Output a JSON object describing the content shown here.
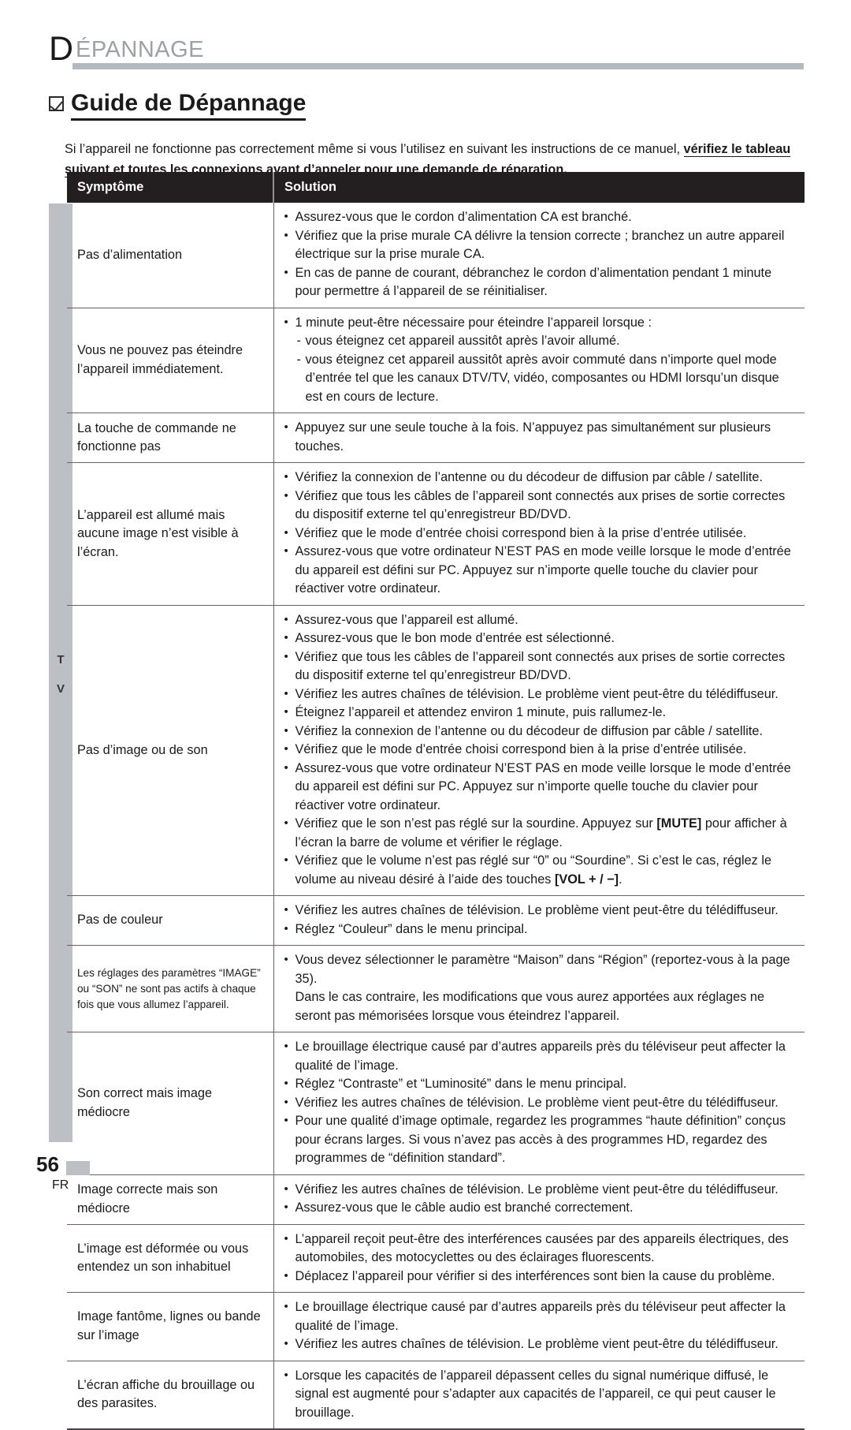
{
  "header": {
    "dropcap": "D",
    "rest": "ÉPANNAGE"
  },
  "section": {
    "title": "Guide de Dépannage",
    "icon": "checkbox-checked-icon"
  },
  "intro": {
    "normal": "Si l’appareil ne fonctionne pas correctement même si vous l’utilisez en suivant les instructions de ce manuel, ",
    "bold": "vérifiez le tableau suivant et toutes les connexions avant d’appeler pour une demande de réparation."
  },
  "side_tab": {
    "letters": [
      "T",
      "V"
    ]
  },
  "table": {
    "headers": {
      "symptom": "Symptôme",
      "solution": "Solution"
    },
    "rows": [
      {
        "symptom": "Pas d’alimentation",
        "solutions": [
          "Assurez-vous que le cordon d’alimentation CA est branché.",
          "Vérifiez que la prise murale CA délivre la tension correcte ; branchez un autre appareil électrique sur la prise murale CA.",
          "En cas de panne de courant, débranchez le cordon d’alimentation pendant 1 minute pour permettre á l’appareil de se réinitialiser."
        ]
      },
      {
        "symptom": "Vous ne pouvez pas éteindre l’appareil immédiatement.",
        "solutions": [
          "1 minute peut-être nécessaire pour éteindre l’appareil lorsque :"
        ],
        "sub_solutions": [
          "vous éteignez cet appareil aussitôt après l’avoir allumé.",
          "vous éteignez cet appareil aussitôt après avoir commuté dans n’importe quel mode d’entrée tel que les canaux DTV/TV, vidéo, composantes ou HDMI lorsqu’un disque est en cours de lecture."
        ]
      },
      {
        "symptom": "La touche de commande ne fonctionne pas",
        "solutions": [
          "Appuyez sur une seule touche à la fois. N’appuyez pas simultanément sur plusieurs touches."
        ]
      },
      {
        "symptom": "L’appareil est allumé mais aucune image n’est visible à l’écran.",
        "solutions": [
          "Vérifiez la connexion de l’antenne ou du décodeur de diffusion par câble / satellite.",
          "Vérifiez que tous les câbles de l’appareil sont connectés aux prises de sortie correctes du dispositif externe tel qu’enregistreur BD/DVD.",
          "Vérifiez que le mode d’entrée choisi correspond bien à la prise d’entrée utilisée.",
          "Assurez-vous que votre ordinateur N’EST PAS en mode veille lorsque le mode d’entrée du appareil est défini sur PC. Appuyez sur n’importe quelle touche du clavier pour réactiver votre ordinateur."
        ]
      },
      {
        "symptom": "Pas d’image ou de son",
        "solutions": [
          "Assurez-vous que l’appareil est allumé.",
          "Assurez-vous que le bon mode d’entrée est sélectionné.",
          "Vérifiez que tous les câbles de l’appareil sont connectés aux prises de sortie correctes du dispositif externe tel qu’enregistreur BD/DVD.",
          "Vérifiez les autres chaînes de télévision. Le problème vient peut-être du télédiffuseur.",
          "Éteignez l’appareil et attendez environ 1 minute, puis rallumez-le.",
          "Vérifiez la connexion de l’antenne ou du décodeur de diffusion par câble / satellite.",
          "Vérifiez que le mode d’entrée choisi correspond bien à la prise d’entrée utilisée.",
          "Assurez-vous que votre ordinateur N’EST PAS en mode veille lorsque le mode d’entrée du appareil est défini sur PC. Appuyez sur n’importe quelle touche du clavier pour réactiver votre ordinateur."
        ],
        "solutions_rich": [
          {
            "pre": "Vérifiez que le son n’est pas réglé sur la sourdine. Appuyez sur ",
            "kbd": "[MUTE]",
            "post": " pour afficher à l’écran la barre de volume et vérifier le réglage."
          },
          {
            "pre": "Vérifiez que le volume n’est pas réglé sur “0” ou “Sourdine”. Si c’est le cas, réglez le volume au niveau désiré à l’aide des touches ",
            "kbd": "[VOL + / −]",
            "post": "."
          }
        ]
      },
      {
        "symptom": "Pas de couleur",
        "solutions": [
          "Vérifiez les autres chaînes de télévision. Le problème vient peut-être du télédiffuseur.",
          "Réglez “Couleur” dans le menu principal."
        ]
      },
      {
        "symptom": "Les réglages des paramètres “IMAGE” ou “SON” ne sont pas actifs à chaque fois que vous allumez l’appareil.",
        "symptom_small": true,
        "solutions": [
          "Vous devez sélectionner le paramètre “Maison” dans “Région” (reportez-vous à la page 35)."
        ],
        "continuation": "Dans le cas contraire, les modifications que vous aurez apportées aux réglages ne seront pas mémorisées lorsque vous éteindrez l’appareil."
      },
      {
        "symptom": "Son correct mais image médiocre",
        "solutions": [
          "Le brouillage électrique causé par d’autres appareils près du téléviseur peut affecter la qualité de l’image.",
          "Réglez “Contraste” et “Luminosité” dans le menu principal.",
          "Vérifiez les autres chaînes de télévision. Le problème vient peut-être du télédiffuseur.",
          "Pour une qualité d’image optimale, regardez les programmes “haute définition” conçus pour écrans larges. Si vous n’avez pas accès à des programmes HD, regardez des programmes de “définition standard”."
        ]
      },
      {
        "symptom": "Image correcte mais son médiocre",
        "solutions": [
          "Vérifiez les autres chaînes de télévision. Le problème vient peut-être du télédiffuseur.",
          "Assurez-vous que le câble audio est branché correctement."
        ]
      },
      {
        "symptom": "L’image est déformée ou vous entendez un son inhabituel",
        "solutions": [
          "L’appareil reçoit peut-être des interférences causées par des appareils électriques, des automobiles, des motocyclettes ou des éclairages fluorescents.",
          "Déplacez l’appareil pour vérifier si des interférences sont bien la cause du problème."
        ]
      },
      {
        "symptom": "Image fantôme, lignes ou bande sur l’image",
        "solutions": [
          "Le brouillage électrique causé par d’autres appareils près du téléviseur peut affecter la qualité de l’image.",
          "Vérifiez les autres chaînes de télévision. Le problème vient peut-être du télédiffuseur."
        ]
      },
      {
        "symptom": "L’écran affiche du brouillage ou des parasites.",
        "solutions": [
          "Lorsque les capacités de l’appareil dépassent celles du signal numérique diffusé, le signal est augmenté pour s’adapter aux capacités de l’appareil, ce qui peut causer le brouillage."
        ]
      }
    ]
  },
  "footer": {
    "page_number": "56",
    "language": "FR"
  }
}
